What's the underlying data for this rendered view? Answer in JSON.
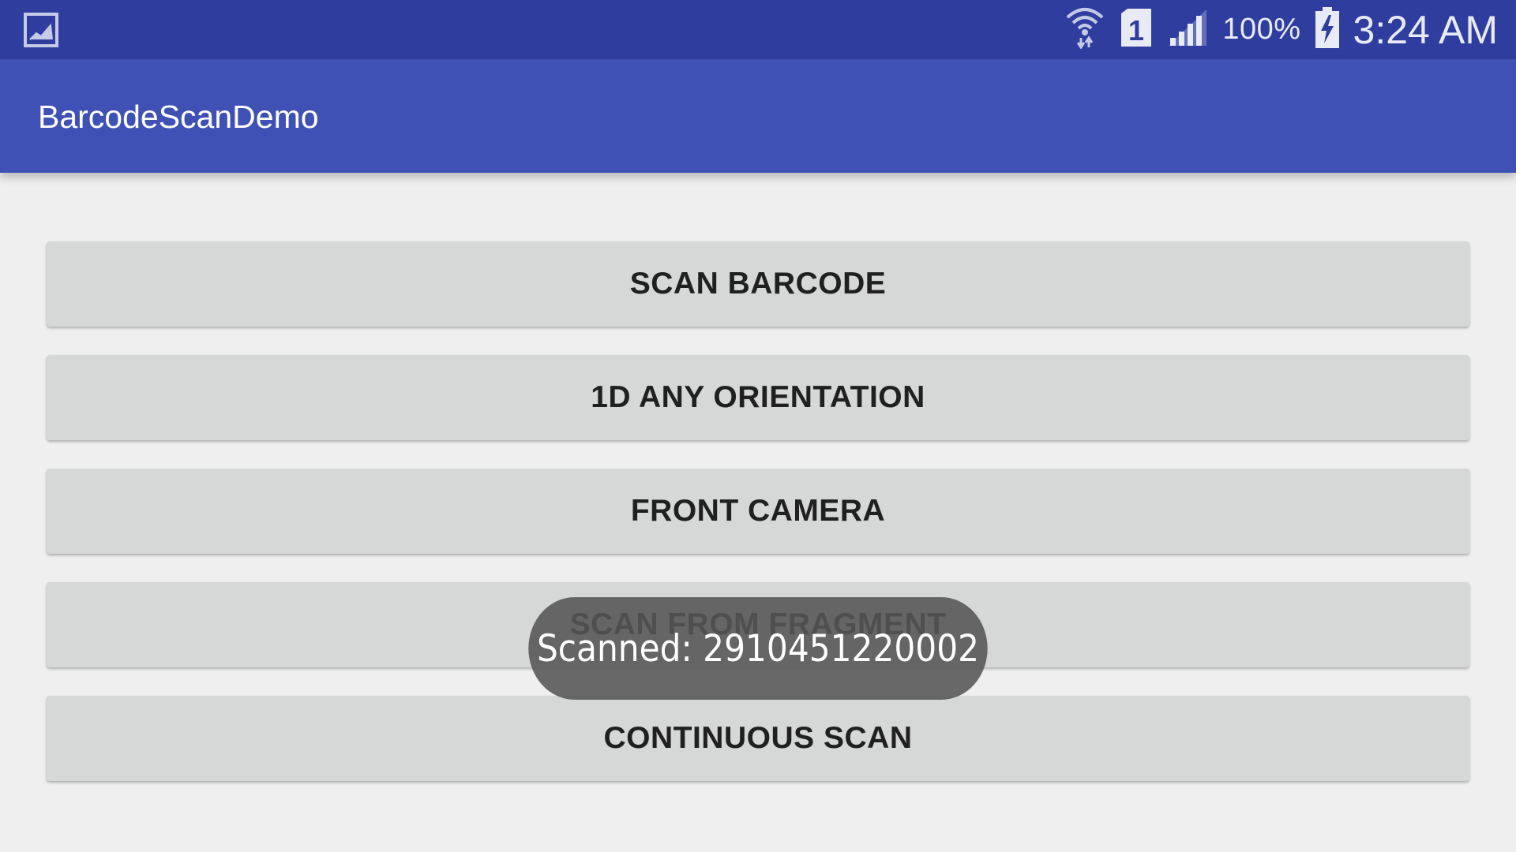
{
  "status_bar": {
    "notification_icon": "gallery-icon",
    "wifi_icon": "wifi-icon",
    "sim_icon": "sim-1-icon",
    "sim_label": "1",
    "signal_icon": "cell-signal-icon",
    "battery_percent": "100%",
    "battery_icon": "battery-charging-icon",
    "time": "3:24 AM"
  },
  "app_bar": {
    "title": "BarcodeScanDemo"
  },
  "buttons": [
    {
      "label": "SCAN BARCODE"
    },
    {
      "label": "1D ANY ORIENTATION"
    },
    {
      "label": "FRONT CAMERA"
    },
    {
      "label": "SCAN FROM FRAGMENT"
    },
    {
      "label": "CONTINUOUS SCAN"
    }
  ],
  "toast": {
    "message": "Scanned: 2910451220002"
  },
  "colors": {
    "status_bar": "#2f3e9e",
    "app_bar": "#3f51b5",
    "background": "#efefef",
    "button": "#d6d7d7",
    "toast": "#555555"
  }
}
